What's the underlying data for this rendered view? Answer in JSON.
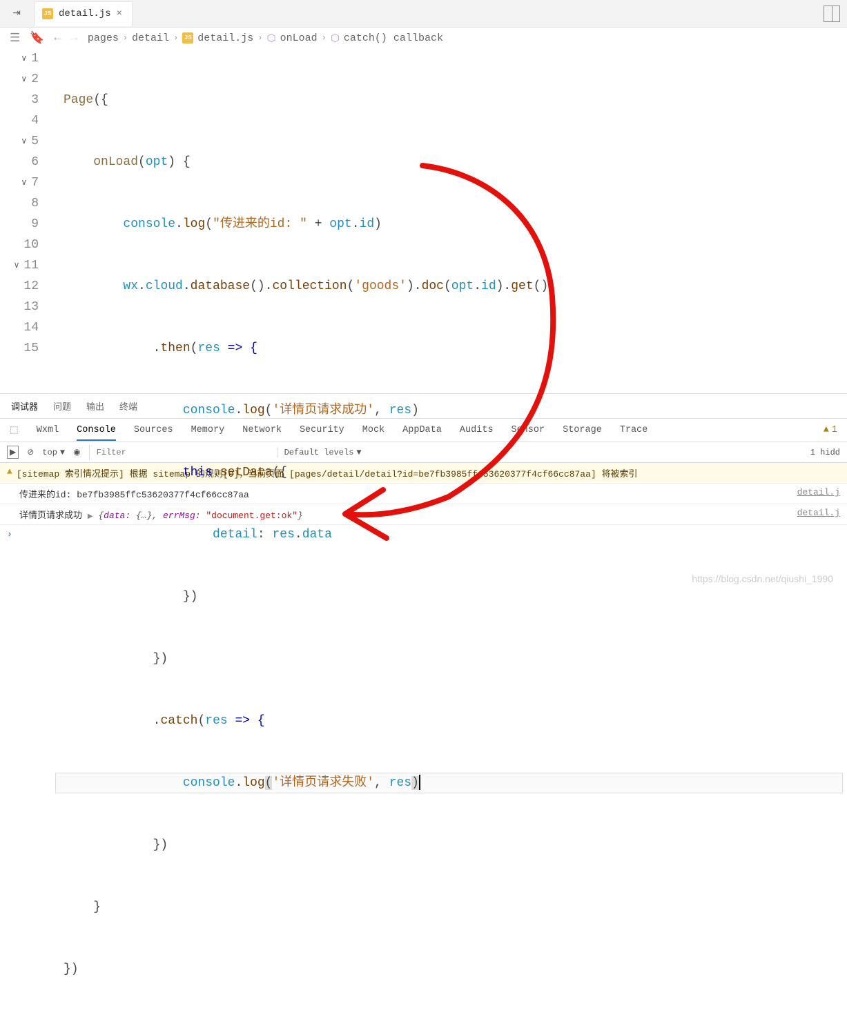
{
  "tab": {
    "filename": "detail.js",
    "icon_label": "JS"
  },
  "breadcrumb": {
    "seg1": "pages",
    "seg2": "detail",
    "seg3": "detail.js",
    "seg4": "onLoad",
    "seg5": "catch() callback"
  },
  "line_numbers": [
    "1",
    "2",
    "3",
    "4",
    "5",
    "6",
    "7",
    "8",
    "9",
    "10",
    "11",
    "12",
    "13",
    "14",
    "15"
  ],
  "code": {
    "l1": {
      "a": "Page",
      "b": "(",
      "c": "{"
    },
    "l2": {
      "indent": "    ",
      "a": "onLoad",
      "b": "(",
      "c": "opt",
      "d": ") {"
    },
    "l3": {
      "indent": "        ",
      "a": "console",
      "b": ".",
      "c": "log",
      "d": "(",
      "e": "\"传进来的id: \"",
      "f": " + ",
      "g": "opt",
      "h": ".",
      "i": "id",
      "j": ")"
    },
    "l4": {
      "indent": "        ",
      "a": "wx",
      "b": ".",
      "c": "cloud",
      "d": ".",
      "e": "database",
      "f": "().",
      "g": "collection",
      "h": "(",
      "i": "'goods'",
      "j": ").",
      "k": "doc",
      "l": "(",
      "m": "opt",
      "n": ".",
      "o": "id",
      "p": ").",
      "q": "get",
      "r": "()"
    },
    "l5": {
      "indent": "            ",
      "a": ".",
      "b": "then",
      "c": "(",
      "d": "res",
      "e": " => {"
    },
    "l6": {
      "indent": "                ",
      "a": "console",
      "b": ".",
      "c": "log",
      "d": "(",
      "e": "'详情页请求成功'",
      "f": ", ",
      "g": "res",
      "h": ")"
    },
    "l7": {
      "indent": "                ",
      "a": "this",
      "b": ".",
      "c": "setData",
      "d": "({",
      "e": ""
    },
    "l8": {
      "indent": "                    ",
      "a": "detail",
      "b": ": ",
      "c": "res",
      "d": ".",
      "e": "data"
    },
    "l9": {
      "indent": "                ",
      "a": "})"
    },
    "l10": {
      "indent": "            ",
      "a": "})"
    },
    "l11": {
      "indent": "            ",
      "a": ".",
      "b": "catch",
      "c": "(",
      "d": "res",
      "e": " => {"
    },
    "l12": {
      "indent": "                ",
      "a": "console",
      "b": ".",
      "c": "log",
      "d": "(",
      "e": "'详情页请求失败'",
      "f": ", ",
      "g": "res",
      "h": ")"
    },
    "l13": {
      "indent": "            ",
      "a": "})"
    },
    "l14": {
      "indent": "    ",
      "a": "}"
    },
    "l15": {
      "a": "})"
    }
  },
  "panel_tabs": {
    "t1": "调试器",
    "t2": "问题",
    "t3": "输出",
    "t4": "终端"
  },
  "devtools_tabs": {
    "t1": "Wxml",
    "t2": "Console",
    "t3": "Sources",
    "t4": "Memory",
    "t5": "Network",
    "t6": "Security",
    "t7": "Mock",
    "t8": "AppData",
    "t9": "Audits",
    "t10": "Sensor",
    "t11": "Storage",
    "t12": "Trace",
    "warn": "1"
  },
  "console_ctrl": {
    "context": "top",
    "filter_placeholder": "Filter",
    "levels": "Default levels",
    "hidden": "1 hidd"
  },
  "console": {
    "row1": "[sitemap 索引情况提示] 根据 sitemap 的规则[0]，当前页面 [pages/detail/detail?id=be7fb3985ffc53620377f4cf66cc87aa] 将被索引",
    "row2": "传进来的id: be7fb3985ffc53620377f4cf66cc87aa",
    "row3_prefix": "详情页请求成功 ",
    "row3_obj_open": "{",
    "row3_k1": "data:",
    "row3_v1": " {…}, ",
    "row3_k2": "errMsg:",
    "row3_v2": " \"document.get:ok\"",
    "row3_obj_close": "}",
    "src2": "detail.j",
    "src3": "detail.j"
  },
  "watermark": "https://blog.csdn.net/qiushi_1990"
}
